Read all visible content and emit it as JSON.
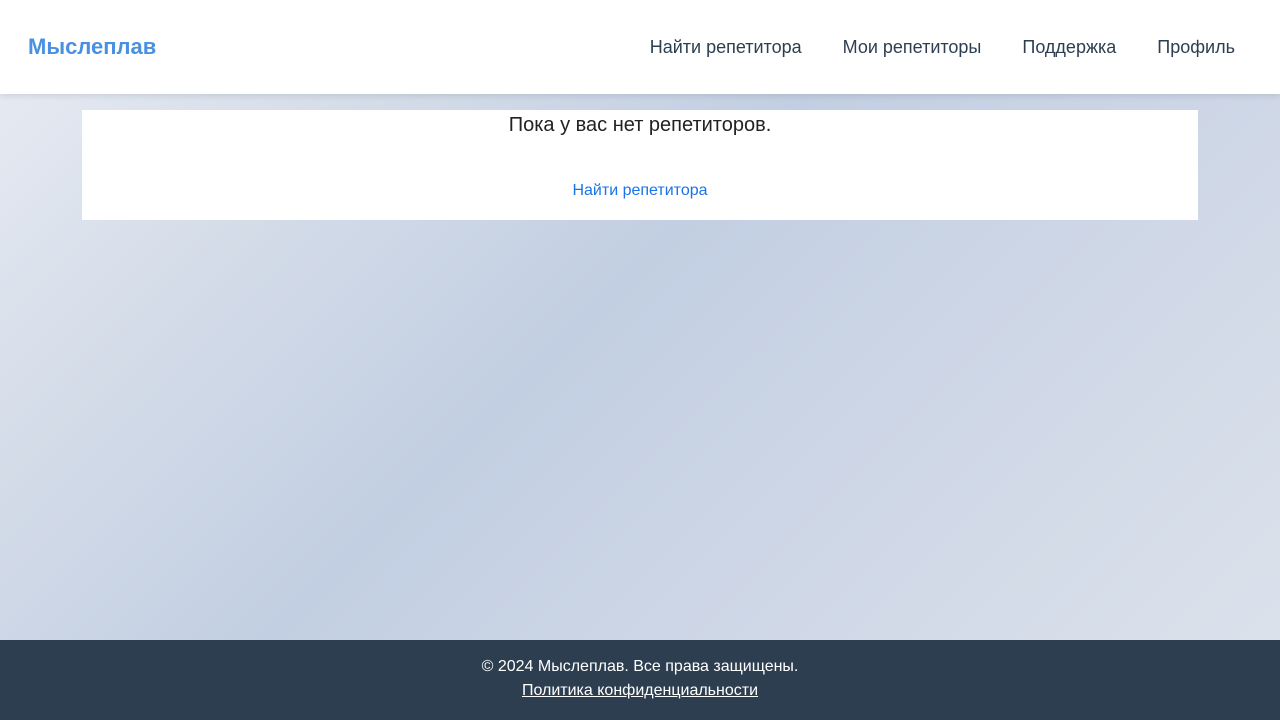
{
  "header": {
    "logo": "Мыслеплав",
    "nav": {
      "find_tutor": "Найти репетитора",
      "my_tutors": "Мои репетиторы",
      "support": "Поддержка",
      "profile": "Профиль"
    }
  },
  "main": {
    "empty_message": "Пока у вас нет репетиторов.",
    "find_link": "Найти репетитора"
  },
  "footer": {
    "copyright": "© 2024 Мыслеплав. Все права защищены.",
    "privacy": "Политика конфиденциальности"
  },
  "colors": {
    "brand": "#4a90e2",
    "link": "#1a73e8",
    "footer_bg": "#2c3e50"
  }
}
